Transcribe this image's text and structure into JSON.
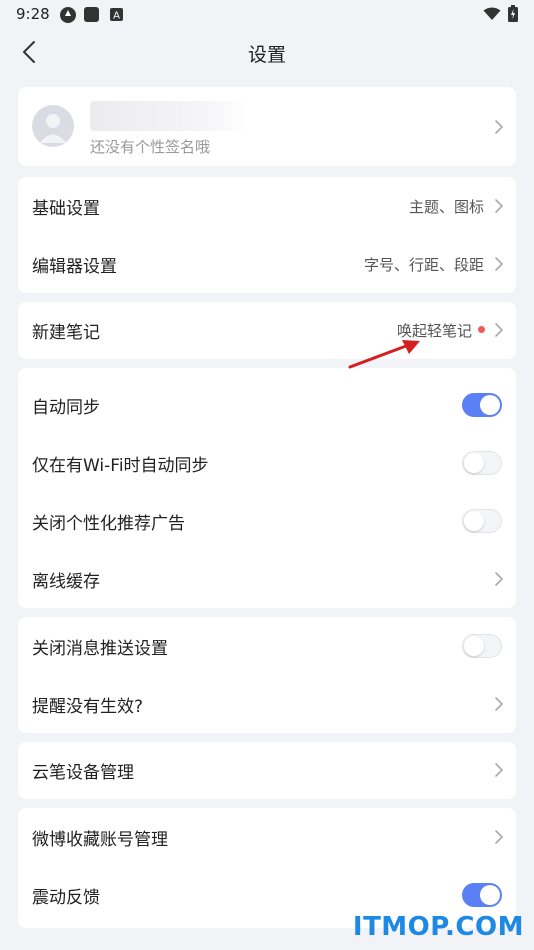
{
  "status_bar": {
    "time": "9:28"
  },
  "header": {
    "title": "设置"
  },
  "profile": {
    "signature": "还没有个性签名哦"
  },
  "sections": {
    "display": [
      {
        "label": "基础设置",
        "value": "主题、图标"
      },
      {
        "label": "编辑器设置",
        "value": "字号、行距、段距"
      }
    ],
    "new_note": {
      "label": "新建笔记",
      "value": "唤起轻笔记"
    },
    "sync": [
      {
        "label": "自动同步",
        "toggle": true
      },
      {
        "label": "仅在有Wi-Fi时自动同步",
        "toggle": false
      },
      {
        "label": "关闭个性化推荐广告",
        "toggle": false
      },
      {
        "label": "离线缓存"
      }
    ],
    "notify": [
      {
        "label": "关闭消息推送设置",
        "toggle": false
      },
      {
        "label": "提醒没有生效?"
      }
    ],
    "device": [
      {
        "label": "云笔设备管理"
      }
    ],
    "account": [
      {
        "label": "微博收藏账号管理"
      },
      {
        "label": "震动反馈",
        "toggle": true
      }
    ]
  },
  "colors": {
    "accent": "#5b7ff4",
    "badge": "#f05b5b",
    "arrow": "#d42020"
  },
  "watermark": "ITMOP.COM"
}
